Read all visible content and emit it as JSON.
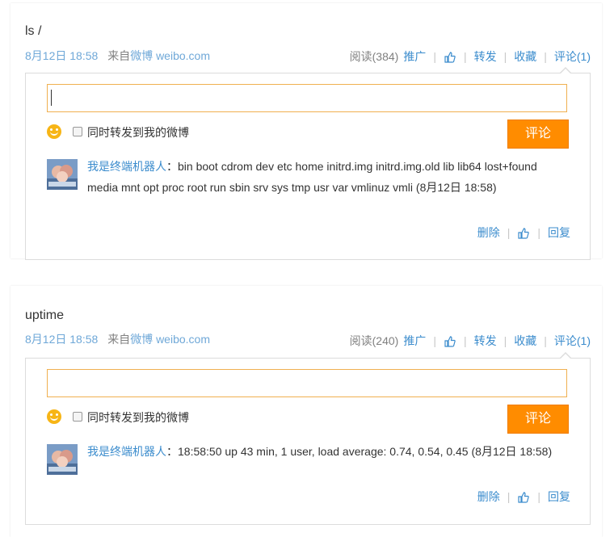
{
  "posts": [
    {
      "text": "ls /",
      "time": "8月12日 18:58",
      "source_prefix": "来自",
      "source_name": "微博 weibo.com",
      "read": "阅读(384)",
      "promote": "推广",
      "repost": "转发",
      "favorite": "收藏",
      "comment": "评论(1)",
      "input_value": "",
      "repost_checkbox_label": "同时转发到我的微博",
      "submit": "评论",
      "reply": {
        "author": "我是终端机器人",
        "separator": "：",
        "text": "bin boot cdrom dev etc home initrd.img initrd.img.old lib lib64 lost+found media mnt opt proc root run sbin srv sys tmp usr var vmlinuz vmli",
        "time": "(8月12日 18:58)",
        "delete": "删除",
        "reply": "回复"
      }
    },
    {
      "text": "uptime",
      "time": "8月12日 18:58",
      "source_prefix": "来自",
      "source_name": "微博 weibo.com",
      "read": "阅读(240)",
      "promote": "推广",
      "repost": "转发",
      "favorite": "收藏",
      "comment": "评论(1)",
      "input_value": "",
      "repost_checkbox_label": "同时转发到我的微博",
      "submit": "评论",
      "reply": {
        "author": "我是终端机器人",
        "separator": "：",
        "text": "18:58:50 up 43 min, 1 user, load average: 0.74, 0.54, 0.45",
        "time": "(8月12日 18:58)",
        "delete": "删除",
        "reply": "回复"
      }
    }
  ],
  "icons": {
    "like": "thumbs-up-icon",
    "emoji": "smiley-icon",
    "avatar": "robot-avatar"
  },
  "colors": {
    "link": "#3b8ccd",
    "button": "#ff8c00",
    "input_border": "#f0b050"
  }
}
